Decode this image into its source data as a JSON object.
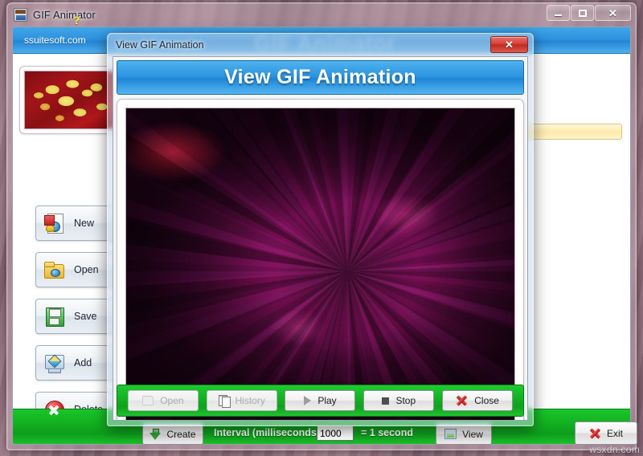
{
  "main_window": {
    "title": "GIF Animator",
    "title_icon": "gif-animator-icon",
    "controls": {
      "minimize": "–",
      "maximize": "□",
      "close": "✕"
    },
    "brand": "ssuitesoft.com",
    "ghost_title": "GIF Animator",
    "sidebar_buttons": [
      {
        "label": "New",
        "icon": "new-image-icon"
      },
      {
        "label": "Open",
        "icon": "open-folder-icon"
      },
      {
        "label": "Save",
        "icon": "floppy-save-icon"
      },
      {
        "label": "Add",
        "icon": "add-monitor-icon"
      },
      {
        "label": "Delete",
        "icon": "delete-circle-icon"
      }
    ],
    "footer": {
      "help": "?",
      "create_label": "Create",
      "interval_label": "Interval (milliseconds)",
      "interval_value": "1000",
      "interval_placeholder": "1000",
      "interval_equals": "= 1 second",
      "view_label": "View",
      "exit_label": "Exit"
    }
  },
  "dialog": {
    "titlebar_text": "View GIF Animation",
    "close_glyph": "✕",
    "heading": "View GIF Animation",
    "preview_alt": "dahlia-flower-preview",
    "buttons": [
      {
        "label": "Open",
        "icon": "open-folder-icon",
        "enabled": false
      },
      {
        "label": "History",
        "icon": "history-pages-icon",
        "enabled": false
      },
      {
        "label": "Play",
        "icon": "play-triangle-icon",
        "enabled": true
      },
      {
        "label": "Stop",
        "icon": "stop-square-icon",
        "enabled": true
      },
      {
        "label": "Close",
        "icon": "red-x-icon",
        "enabled": true
      }
    ]
  },
  "watermark": "wsxdn.com",
  "colors": {
    "brand_blue": "#2f92de",
    "footer_green": "#13b222",
    "close_red": "#d64238",
    "help_yellow": "#f2f24a"
  }
}
